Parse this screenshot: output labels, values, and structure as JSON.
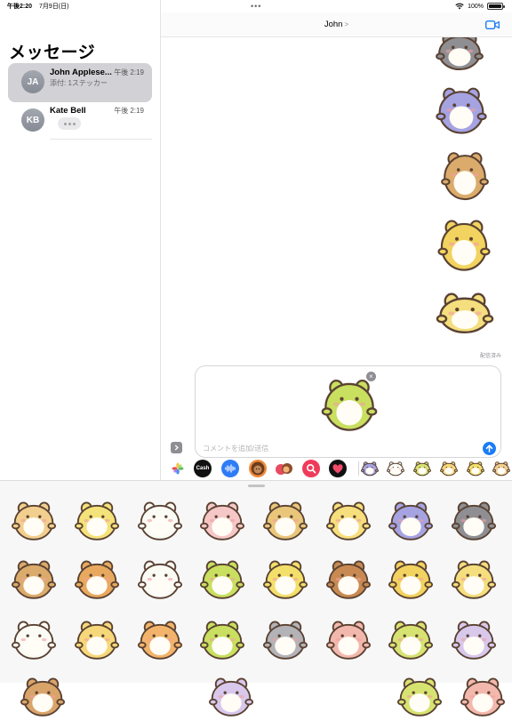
{
  "status_bar": {
    "time": "午後2:20",
    "date": "7月9日(日)",
    "battery": "100%",
    "battery_level": 1.0
  },
  "sidebar": {
    "title": "メッセージ",
    "conversations": [
      {
        "initials": "JA",
        "name": "John Applese...",
        "time": "午後 2:19",
        "preview": "添付: 1ステッカー"
      },
      {
        "initials": "KB",
        "name": "Kate Bell",
        "time": "午後 2:19",
        "preview": ""
      }
    ]
  },
  "header": {
    "contact_name": "John",
    "chevron": ">"
  },
  "transcript": {
    "status": "配信済み"
  },
  "composer": {
    "placeholder": "コメントを追加/送信",
    "remove_glyph": "×"
  },
  "app_drawer": {
    "apps": [
      {
        "name": "photos-app",
        "label": ""
      },
      {
        "name": "apple-cash-app",
        "label": "Cash"
      },
      {
        "name": "audio-message-app",
        "label": ""
      },
      {
        "name": "memoji-app",
        "label": ""
      },
      {
        "name": "memoji-stickers-app",
        "label": ""
      },
      {
        "name": "images-search-app",
        "label": ""
      },
      {
        "name": "digital-touch-app",
        "label": ""
      }
    ]
  },
  "colors": {
    "accent": "#1b7cf5",
    "selected_row": "#d1d1d6",
    "sticker_outline": "#5a4232"
  },
  "stickers": [
    {
      "name": "hamster",
      "body": "#f2cf8e"
    },
    {
      "name": "yellow-bunny",
      "body": "#f4e27a"
    },
    {
      "name": "white-sheep",
      "body": "#fbfbf6"
    },
    {
      "name": "pink-bunny",
      "body": "#f5c7c7"
    },
    {
      "name": "hedgehog",
      "body": "#e9c67a"
    },
    {
      "name": "yellow-cat",
      "body": "#f6df7c"
    },
    {
      "name": "purple-cat",
      "body": "#a5a3e2"
    },
    {
      "name": "grey-seal",
      "body": "#8f8f93"
    },
    {
      "name": "brown-otter",
      "body": "#dbab6c"
    },
    {
      "name": "orange-hamster",
      "body": "#e8a95f"
    },
    {
      "name": "white-bunny",
      "body": "#fbfbf6"
    },
    {
      "name": "green-dino",
      "body": "#c8df5f"
    },
    {
      "name": "yellow-chick",
      "body": "#f3e06a"
    },
    {
      "name": "brown-poodle",
      "body": "#c88a52"
    },
    {
      "name": "lion",
      "body": "#f2d35f"
    },
    {
      "name": "turtle",
      "body": "#f4de7e"
    },
    {
      "name": "cow",
      "body": "#fbfbf6"
    },
    {
      "name": "shiba-dog",
      "body": "#f6d87a"
    },
    {
      "name": "tiger",
      "body": "#f2b46b"
    },
    {
      "name": "green-croc",
      "body": "#c8df5f"
    },
    {
      "name": "grey-mouse",
      "body": "#b3b2b7"
    },
    {
      "name": "pink-pig",
      "body": "#f3b8ad"
    },
    {
      "name": "green-frog",
      "body": "#d7e371"
    },
    {
      "name": "purple-owl",
      "body": "#d8c8ec"
    },
    {
      "name": "red-panda",
      "body": "#d9a46a"
    }
  ],
  "sent_stickers": [
    {
      "name": "grey-seal",
      "body": "#8f8f93"
    },
    {
      "name": "purple-cat",
      "body": "#a5a3e2"
    },
    {
      "name": "brown-otter",
      "body": "#dbab6c"
    },
    {
      "name": "lion",
      "body": "#f2d35f"
    },
    {
      "name": "turtle",
      "body": "#f4de7e"
    }
  ],
  "staged_sticker": {
    "name": "green-croc",
    "body": "#c8df5f"
  }
}
